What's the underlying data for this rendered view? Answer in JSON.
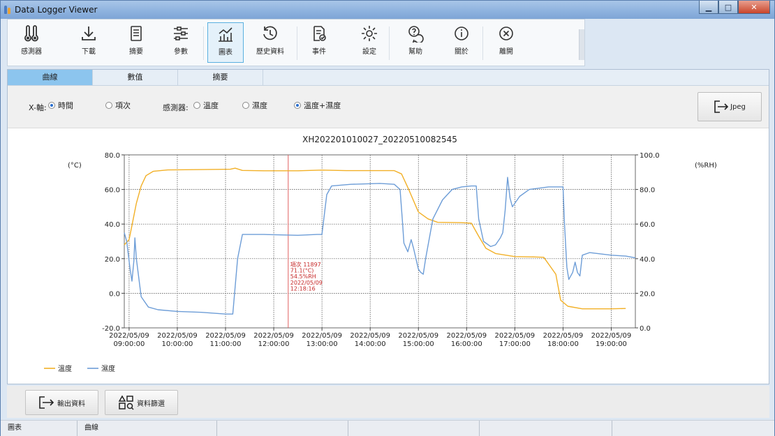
{
  "window": {
    "title": "Data Logger Viewer"
  },
  "toolbar": {
    "items": [
      {
        "label": "感測器",
        "icon": "thermometer-icon"
      },
      {
        "label": "下載",
        "icon": "download-icon"
      },
      {
        "label": "摘要",
        "icon": "document-icon"
      },
      {
        "label": "參數",
        "icon": "sliders-icon"
      },
      {
        "label": "圖表",
        "icon": "chart-icon",
        "active": true
      },
      {
        "label": "歷史資料",
        "icon": "history-icon"
      },
      {
        "label": "事件",
        "icon": "event-icon"
      },
      {
        "label": "設定",
        "icon": "gear-icon"
      },
      {
        "label": "幫助",
        "icon": "help-icon"
      },
      {
        "label": "關於",
        "icon": "info-icon"
      },
      {
        "label": "離開",
        "icon": "close-icon"
      }
    ]
  },
  "tabs": [
    {
      "label": "曲線",
      "active": true
    },
    {
      "label": "數值"
    },
    {
      "label": "摘要"
    }
  ],
  "options": {
    "xaxis_label": "X-軸:",
    "xaxis_time": "時間",
    "xaxis_count": "項次",
    "sensor_label": "感測器:",
    "sensor_temp": "溫度",
    "sensor_hum": "濕度",
    "sensor_both": "溫度+濕度",
    "jpeg_label": "Jpeg"
  },
  "chart_data": {
    "type": "line",
    "title": "XH202201010027_20220510082545",
    "ylabel_left": "(°C)",
    "ylabel_right": "(%RH)",
    "ylim_left": [
      -20,
      80
    ],
    "ylim_right": [
      0,
      100
    ],
    "yticks_left": [
      "80.0",
      "60.0",
      "40.0",
      "20.0",
      "0.0",
      "-20.0"
    ],
    "yticks_right": [
      "100.0",
      "80.0",
      "60.0",
      "40.0",
      "20.0",
      "0.0"
    ],
    "xlim_hours": [
      8.9,
      19.5
    ],
    "xticks": [
      {
        "date": "2022/05/09",
        "time": "09:00:00",
        "hour": 9
      },
      {
        "date": "2022/05/09",
        "time": "10:00:00",
        "hour": 10
      },
      {
        "date": "2022/05/09",
        "time": "11:00:00",
        "hour": 11
      },
      {
        "date": "2022/05/09",
        "time": "12:00:00",
        "hour": 12
      },
      {
        "date": "2022/05/09",
        "time": "13:00:00",
        "hour": 13
      },
      {
        "date": "2022/05/09",
        "time": "14:00:00",
        "hour": 14
      },
      {
        "date": "2022/05/09",
        "time": "15:00:00",
        "hour": 15
      },
      {
        "date": "2022/05/09",
        "time": "16:00:00",
        "hour": 16
      },
      {
        "date": "2022/05/09",
        "time": "17:00:00",
        "hour": 17
      },
      {
        "date": "2022/05/09",
        "time": "18:00:00",
        "hour": 18
      },
      {
        "date": "2022/05/09",
        "time": "19:00:00",
        "hour": 19
      }
    ],
    "grid": true,
    "legend_position": "bottom-left",
    "series": [
      {
        "name": "溫度",
        "axis": "left",
        "color": "#f2b027",
        "points": [
          [
            8.9,
            28
          ],
          [
            9.0,
            31
          ],
          [
            9.05,
            38
          ],
          [
            9.15,
            52
          ],
          [
            9.25,
            62
          ],
          [
            9.35,
            68
          ],
          [
            9.5,
            70.5
          ],
          [
            9.8,
            71.3
          ],
          [
            10.5,
            71.5
          ],
          [
            11.1,
            71.7
          ],
          [
            11.2,
            72.3
          ],
          [
            11.35,
            71
          ],
          [
            11.8,
            70.8
          ],
          [
            12.5,
            70.8
          ],
          [
            13.0,
            71.2
          ],
          [
            13.5,
            70.9
          ],
          [
            14.0,
            70.9
          ],
          [
            14.5,
            70.9
          ],
          [
            14.65,
            69
          ],
          [
            14.8,
            60
          ],
          [
            15.0,
            47
          ],
          [
            15.2,
            43
          ],
          [
            15.4,
            41
          ],
          [
            15.9,
            40.8
          ],
          [
            16.1,
            40.5
          ],
          [
            16.25,
            33
          ],
          [
            16.4,
            26
          ],
          [
            16.6,
            23
          ],
          [
            17.0,
            21.2
          ],
          [
            17.4,
            21
          ],
          [
            17.6,
            20.8
          ],
          [
            17.85,
            11
          ],
          [
            17.95,
            -4
          ],
          [
            18.1,
            -7.5
          ],
          [
            18.4,
            -9
          ],
          [
            19.0,
            -9
          ],
          [
            19.3,
            -8.8
          ]
        ]
      },
      {
        "name": "濕度",
        "axis": "right",
        "color": "#6d9dd7",
        "points": [
          [
            8.9,
            55
          ],
          [
            8.95,
            50
          ],
          [
            9.02,
            34
          ],
          [
            9.06,
            27
          ],
          [
            9.1,
            39
          ],
          [
            9.12,
            52
          ],
          [
            9.15,
            40
          ],
          [
            9.25,
            18
          ],
          [
            9.4,
            12
          ],
          [
            9.6,
            10.5
          ],
          [
            10.0,
            9.5
          ],
          [
            10.5,
            9
          ],
          [
            11.0,
            8
          ],
          [
            11.15,
            8
          ],
          [
            11.25,
            40
          ],
          [
            11.35,
            54
          ],
          [
            11.8,
            54
          ],
          [
            12.5,
            53.5
          ],
          [
            12.9,
            54
          ],
          [
            13.0,
            54
          ],
          [
            13.1,
            77
          ],
          [
            13.2,
            82
          ],
          [
            13.6,
            83
          ],
          [
            14.2,
            83.5
          ],
          [
            14.5,
            83
          ],
          [
            14.62,
            80
          ],
          [
            14.67,
            61
          ],
          [
            14.7,
            49
          ],
          [
            14.78,
            44
          ],
          [
            14.85,
            51
          ],
          [
            14.9,
            46
          ],
          [
            15.0,
            34
          ],
          [
            15.05,
            32
          ],
          [
            15.1,
            31
          ],
          [
            15.15,
            40
          ],
          [
            15.3,
            63
          ],
          [
            15.5,
            74
          ],
          [
            15.7,
            80
          ],
          [
            15.9,
            81.5
          ],
          [
            16.1,
            82
          ],
          [
            16.2,
            82
          ],
          [
            16.25,
            63
          ],
          [
            16.35,
            50
          ],
          [
            16.5,
            47
          ],
          [
            16.6,
            48
          ],
          [
            16.7,
            52
          ],
          [
            16.75,
            55
          ],
          [
            16.8,
            68
          ],
          [
            16.85,
            87
          ],
          [
            16.9,
            75
          ],
          [
            16.95,
            70
          ],
          [
            17.1,
            76
          ],
          [
            17.3,
            80
          ],
          [
            17.7,
            81.5
          ],
          [
            18.0,
            81.5
          ],
          [
            18.03,
            60
          ],
          [
            18.08,
            35
          ],
          [
            18.12,
            28
          ],
          [
            18.2,
            32
          ],
          [
            18.25,
            38
          ],
          [
            18.3,
            32
          ],
          [
            18.35,
            30
          ],
          [
            18.4,
            42
          ],
          [
            18.55,
            43.5
          ],
          [
            19.0,
            42
          ],
          [
            19.3,
            41.5
          ],
          [
            19.5,
            40.5
          ]
        ]
      }
    ],
    "marker": {
      "hour": 12.3,
      "color": "#e06060",
      "lines": [
        "項次 11897",
        "71.1(°C)",
        "54.5%RH",
        "2022/05/09",
        "12:18:16"
      ]
    }
  },
  "actions": {
    "export_label": "輸出資料",
    "filter_label": "資料篩選"
  },
  "statusbar": {
    "cells": [
      "圖表",
      "曲線",
      "",
      "",
      "",
      ""
    ]
  }
}
